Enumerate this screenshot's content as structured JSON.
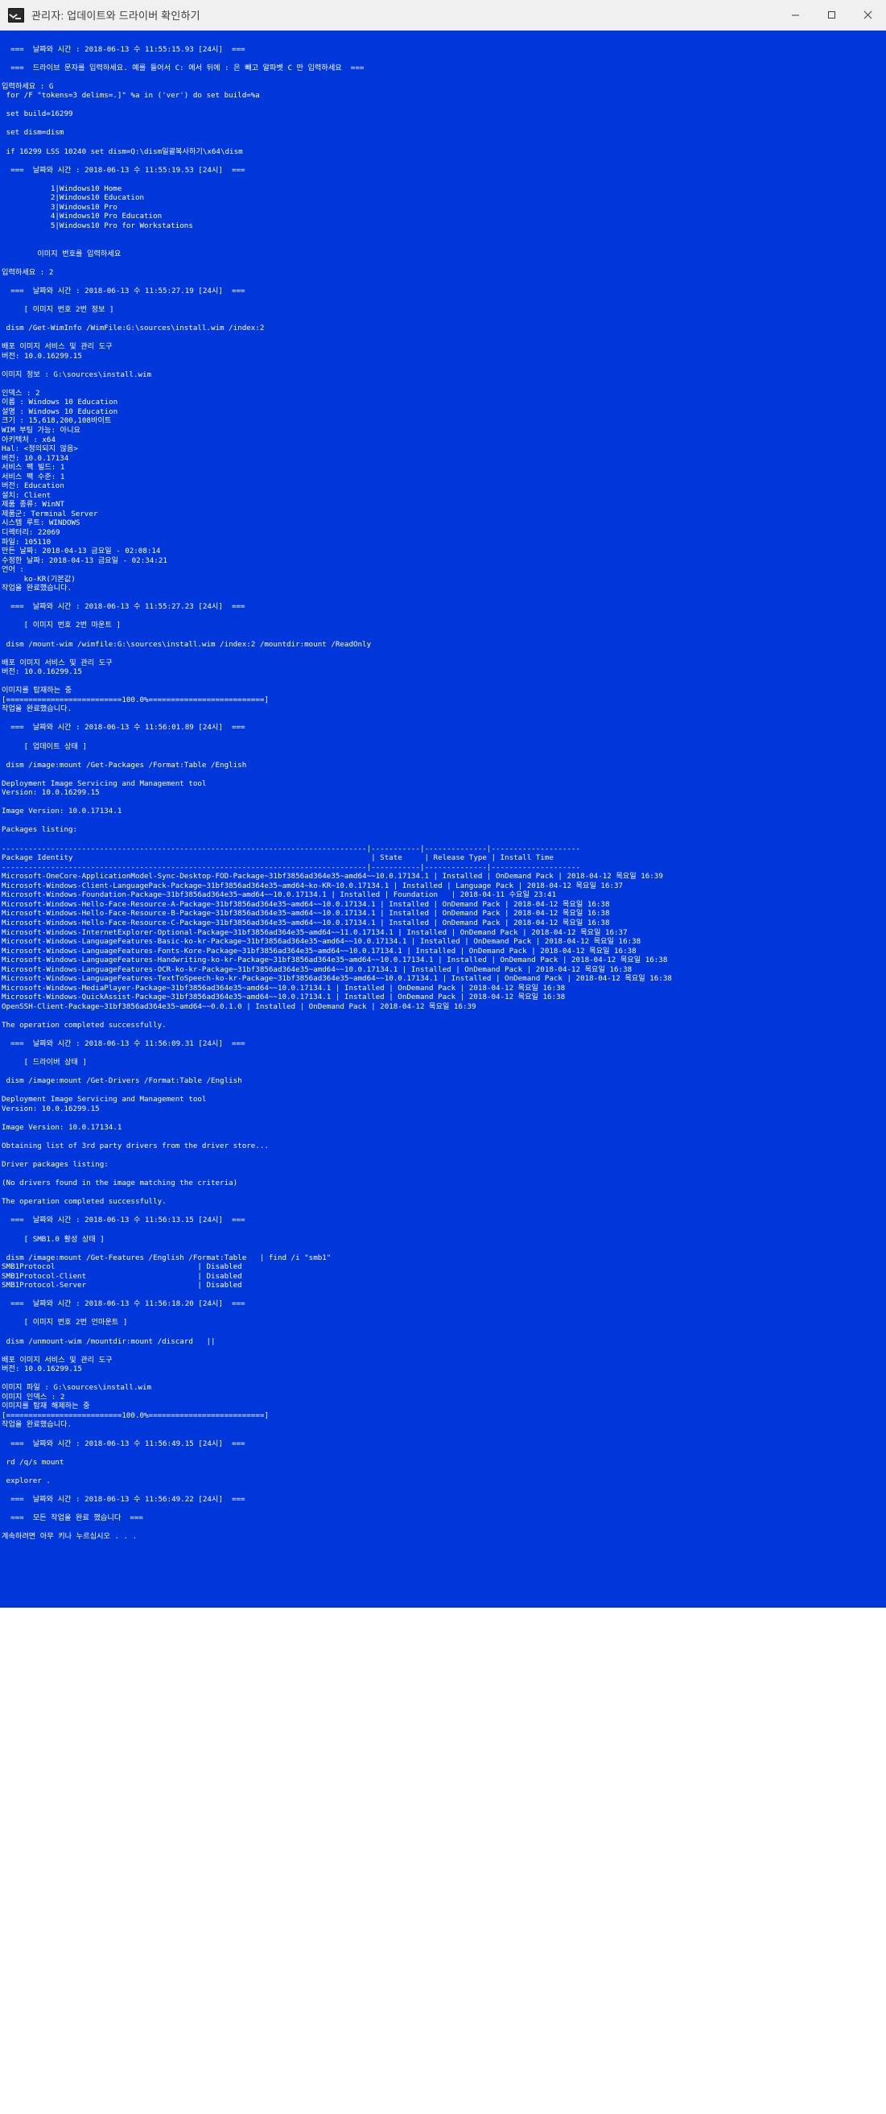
{
  "window": {
    "title": "관리자: 업데이트와 드라이버 확인하기",
    "icon": "console-icon",
    "buttons": {
      "minimize": "minimize-button",
      "maximize": "maximize-button",
      "close": "close-button"
    }
  },
  "colors": {
    "console_bg": "#0037da",
    "console_fg": "#ffffff",
    "titlebar_bg": "#f0f0f0",
    "titlebar_fg": "#3b3b3b"
  },
  "console": {
    "lines": [
      "",
      "  ===  날짜와 시간 : 2018-06-13 수 11:55:15.93 [24시]  ===",
      "",
      "  ===  드라이브 문자를 입력하세요. 예를 들어서 C: 에서 뒤에 : 은 빼고 알파벳 C 만 입력하세요  ===",
      "",
      "입력하세요 : G",
      " for /F \"tokens=3 delims=.]\" %a in ('ver') do set build=%a",
      "",
      " set build=16299",
      "",
      " set dism=dism",
      "",
      " if 16299 LSS 10240 set dism=Q:\\dism일괄복사하기\\x64\\dism",
      "",
      "  ===  날짜와 시간 : 2018-06-13 수 11:55:19.53 [24시]  ===",
      "",
      "           1|Windows10 Home",
      "           2|Windows10 Education",
      "           3|Windows10 Pro",
      "           4|Windows10 Pro Education",
      "           5|Windows10 Pro for Workstations",
      "",
      "",
      "        이미지 번호를 입력하세요",
      "",
      "입력하세요 : 2",
      "",
      "  ===  날짜와 시간 : 2018-06-13 수 11:55:27.19 [24시]  ===",
      "",
      "     [ 이미지 번호 2번 정보 ]",
      "",
      " dism /Get-WimInfo /WimFile:G:\\sources\\install.wim /index:2",
      "",
      "배포 이미지 서비스 및 관리 도구",
      "버전: 10.0.16299.15",
      "",
      "이미지 정보 : G:\\sources\\install.wim",
      "",
      "인덱스 : 2",
      "이름 : Windows 10 Education",
      "설명 : Windows 10 Education",
      "크기 : 15,618,200,108바이트",
      "WIM 부팅 가능: 아니요",
      "아키텍처 : x64",
      "Hal: <정의되지 않음>",
      "버전: 10.0.17134",
      "서비스 팩 빌드: 1",
      "서비스 팩 수준: 1",
      "버전: Education",
      "설치: Client",
      "제품 종류: WinNT",
      "제품군: Terminal Server",
      "시스템 루트: WINDOWS",
      "디렉터리: 22069",
      "파일: 105110",
      "만든 날짜: 2018-04-13 금요일 - 02:08:14",
      "수정한 날짜: 2018-04-13 금요일 - 02:34:21",
      "언어 :",
      "     ko-KR(기본값)",
      "작업을 완료했습니다.",
      "",
      "  ===  날짜와 시간 : 2018-06-13 수 11:55:27.23 [24시]  ===",
      "",
      "     [ 이미지 번호 2번 마운트 ]",
      "",
      " dism /mount-wim /wimfile:G:\\sources\\install.wim /index:2 /mountdir:mount /ReadOnly",
      "",
      "배포 이미지 서비스 및 관리 도구",
      "버전: 10.0.16299.15",
      "",
      "이미지를 탑재하는 중",
      "[==========================100.0%==========================]",
      "작업을 완료했습니다.",
      "",
      "  ===  날짜와 시간 : 2018-06-13 수 11:56:01.89 [24시]  ===",
      "",
      "     [ 업데이트 상태 ]",
      "",
      " dism /image:mount /Get-Packages /Format:Table /English",
      "",
      "Deployment Image Servicing and Management tool",
      "Version: 10.0.16299.15",
      "",
      "Image Version: 10.0.17134.1",
      "",
      "Packages listing:",
      "",
      "----------------------------------------------------------------------------------|-----------|--------------|--------------------",
      "Package Identity                                                                   | State     | Release Type | Install Time",
      "----------------------------------------------------------------------------------|-----------|--------------|--------------------",
      "Microsoft-OneCore-ApplicationModel-Sync-Desktop-FOD-Package~31bf3856ad364e35~amd64~~10.0.17134.1 | Installed | OnDemand Pack | 2018-04-12 목요일 16:39",
      "Microsoft-Windows-Client-LanguagePack-Package~31bf3856ad364e35~amd64~ko-KR~10.0.17134.1 | Installed | Language Pack | 2018-04-12 목요일 16:37",
      "Microsoft-Windows-Foundation-Package~31bf3856ad364e35~amd64~~10.0.17134.1 | Installed | Foundation   | 2018-04-11 수요일 23:41",
      "Microsoft-Windows-Hello-Face-Resource-A-Package~31bf3856ad364e35~amd64~~10.0.17134.1 | Installed | OnDemand Pack | 2018-04-12 목요일 16:38",
      "Microsoft-Windows-Hello-Face-Resource-B-Package~31bf3856ad364e35~amd64~~10.0.17134.1 | Installed | OnDemand Pack | 2018-04-12 목요일 16:38",
      "Microsoft-Windows-Hello-Face-Resource-C-Package~31bf3856ad364e35~amd64~~10.0.17134.1 | Installed | OnDemand Pack | 2018-04-12 목요일 16:38",
      "Microsoft-Windows-InternetExplorer-Optional-Package~31bf3856ad364e35~amd64~~11.0.17134.1 | Installed | OnDemand Pack | 2018-04-12 목요일 16:37",
      "Microsoft-Windows-LanguageFeatures-Basic-ko-kr-Package~31bf3856ad364e35~amd64~~10.0.17134.1 | Installed | OnDemand Pack | 2018-04-12 목요일 16:38",
      "Microsoft-Windows-LanguageFeatures-Fonts-Kore-Package~31bf3856ad364e35~amd64~~10.0.17134.1 | Installed | OnDemand Pack | 2018-04-12 목요일 16:38",
      "Microsoft-Windows-LanguageFeatures-Handwriting-ko-kr-Package~31bf3856ad364e35~amd64~~10.0.17134.1 | Installed | OnDemand Pack | 2018-04-12 목요일 16:38",
      "Microsoft-Windows-LanguageFeatures-OCR-ko-kr-Package~31bf3856ad364e35~amd64~~10.0.17134.1 | Installed | OnDemand Pack | 2018-04-12 목요일 16:38",
      "Microsoft-Windows-LanguageFeatures-TextToSpeech-ko-kr-Package~31bf3856ad364e35~amd64~~10.0.17134.1 | Installed | OnDemand Pack | 2018-04-12 목요일 16:38",
      "Microsoft-Windows-MediaPlayer-Package~31bf3856ad364e35~amd64~~10.0.17134.1 | Installed | OnDemand Pack | 2018-04-12 목요일 16:38",
      "Microsoft-Windows-QuickAssist-Package~31bf3856ad364e35~amd64~~10.0.17134.1 | Installed | OnDemand Pack | 2018-04-12 목요일 16:38",
      "OpenSSH-Client-Package~31bf3856ad364e35~amd64~~0.0.1.0 | Installed | OnDemand Pack | 2018-04-12 목요일 16:39",
      "",
      "The operation completed successfully.",
      "",
      "  ===  날짜와 시간 : 2018-06-13 수 11:56:09.31 [24시]  ===",
      "",
      "     [ 드라이버 상태 ]",
      "",
      " dism /image:mount /Get-Drivers /Format:Table /English",
      "",
      "Deployment Image Servicing and Management tool",
      "Version: 10.0.16299.15",
      "",
      "Image Version: 10.0.17134.1",
      "",
      "Obtaining list of 3rd party drivers from the driver store...",
      "",
      "Driver packages listing:",
      "",
      "(No drivers found in the image matching the criteria)",
      "",
      "The operation completed successfully.",
      "",
      "  ===  날짜와 시간 : 2018-06-13 수 11:56:13.15 [24시]  ===",
      "",
      "     [ SMB1.0 활성 상태 ]",
      "",
      " dism /image:mount /Get-Features /English /Format:Table   | find /i \"smb1\"",
      "SMB1Protocol                                | Disabled",
      "SMB1Protocol-Client                         | Disabled",
      "SMB1Protocol-Server                         | Disabled",
      "",
      "  ===  날짜와 시간 : 2018-06-13 수 11:56:18.20 [24시]  ===",
      "",
      "     [ 이미지 번호 2번 언마운트 ]",
      "",
      " dism /unmount-wim /mountdir:mount /discard   ||",
      "",
      "배포 이미지 서비스 및 관리 도구",
      "버전: 10.0.16299.15",
      "",
      "이미지 파일 : G:\\sources\\install.wim",
      "이미지 인덱스 : 2",
      "이미지를 탑재 해제하는 중",
      "[==========================100.0%==========================]",
      "작업을 완료했습니다.",
      "",
      "  ===  날짜와 시간 : 2018-06-13 수 11:56:49.15 [24시]  ===",
      "",
      " rd /q/s mount",
      "",
      " explorer .",
      "",
      "  ===  날짜와 시간 : 2018-06-13 수 11:56:49.22 [24시]  ===",
      "",
      "  ===  모든 작업을 완료 했습니다  ===",
      "",
      "계속하려면 아무 키나 누르십시오 . . ."
    ]
  }
}
